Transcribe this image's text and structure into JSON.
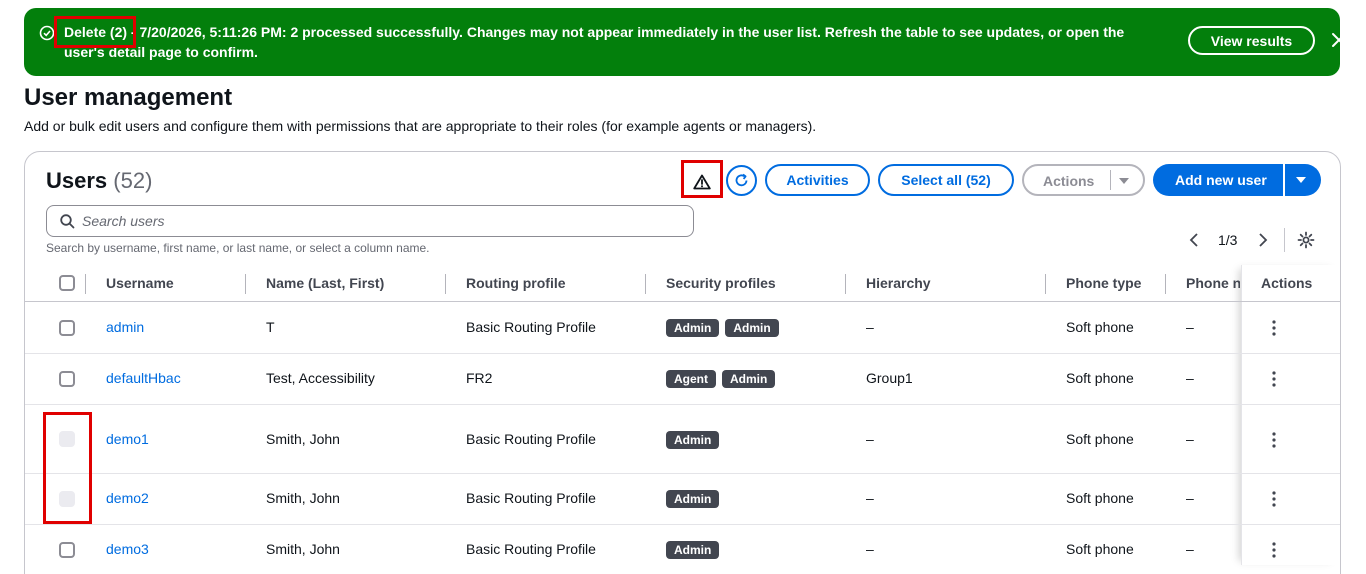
{
  "flash": {
    "message": "Delete (2) - 7/20/2026, 5:11:26 PM: 2 processed successfully. Changes may not appear immediately in the user list. Refresh the table to see updates, or open the user's detail page to confirm.",
    "view_results": "View results",
    "color": "#037f0c"
  },
  "page": {
    "title": "User management",
    "description": "Add or bulk edit users and configure them with permissions that are appropriate to their roles (for example agents or managers)."
  },
  "users": {
    "title": "Users",
    "count": "(52)",
    "buttons": {
      "activities": "Activities",
      "select_all": "Select all (52)",
      "actions": "Actions",
      "add_new_user": "Add new user"
    },
    "search": {
      "placeholder": "Search users",
      "hint": "Search by username, first name, or last name, or select a column name."
    },
    "pagination": "1/3",
    "columns": [
      "Username",
      "Name (Last, First)",
      "Routing profile",
      "Security profiles",
      "Hierarchy",
      "Phone type",
      "Phone n",
      "Actions"
    ],
    "rows": [
      {
        "username": "admin",
        "name": "T",
        "routing": "Basic Routing Profile",
        "security": [
          "Admin",
          "Admin"
        ],
        "hierarchy": "–",
        "phone_type": "Soft phone",
        "phone_number": "–",
        "checkbox": "enabled"
      },
      {
        "username": "defaultHbac",
        "name": "Test, Accessibility",
        "routing": "FR2",
        "security": [
          "Agent",
          "Admin"
        ],
        "hierarchy": "Group1",
        "phone_type": "Soft phone",
        "phone_number": "–",
        "checkbox": "enabled"
      },
      {
        "username": "demo1",
        "name": "Smith, John",
        "routing": "Basic Routing Profile",
        "security": [
          "Admin"
        ],
        "hierarchy": "–",
        "phone_type": "Soft phone",
        "phone_number": "–",
        "checkbox": "disabled"
      },
      {
        "username": "demo2",
        "name": "Smith, John",
        "routing": "Basic Routing Profile",
        "security": [
          "Admin"
        ],
        "hierarchy": "–",
        "phone_type": "Soft phone",
        "phone_number": "–",
        "checkbox": "disabled"
      },
      {
        "username": "demo3",
        "name": "Smith, John",
        "routing": "Basic Routing Profile",
        "security": [
          "Admin"
        ],
        "hierarchy": "–",
        "phone_type": "Soft phone",
        "phone_number": "–",
        "checkbox": "enabled"
      }
    ]
  },
  "colors": {
    "accent": "#006ce0",
    "success": "#037f0c",
    "highlight": "#e00000",
    "badge": "#424650"
  }
}
